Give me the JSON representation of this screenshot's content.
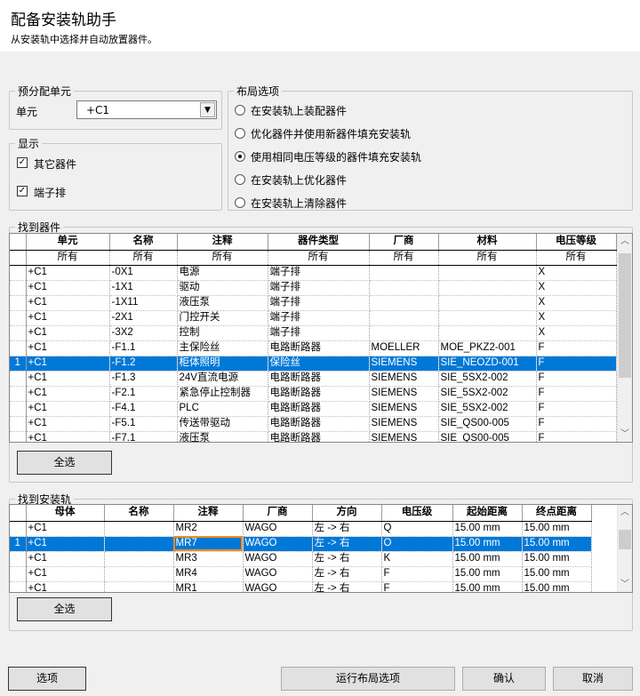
{
  "header": {
    "title": "配备安装轨助手",
    "subtitle": "从安装轨中选择并自动放置器件。"
  },
  "preassign": {
    "legend": "预分配单元",
    "unit_label": "单元",
    "unit_value": "+C1"
  },
  "display": {
    "legend": "显示",
    "other_devices": "其它器件",
    "terminal_strips": "端子排"
  },
  "layout": {
    "legend": "布局选项",
    "options": [
      "在安装轨上装配器件",
      "优化器件并使用新器件填充安装轨",
      "使用相同电压等级的器件填充安装轨",
      "在安装轨上优化器件",
      "在安装轨上清除器件"
    ],
    "selected_index": 2
  },
  "devices": {
    "legend": "找到器件",
    "columns": [
      "单元",
      "名称",
      "注释",
      "器件类型",
      "厂商",
      "材料",
      "电压等级"
    ],
    "filter": [
      "所有",
      "所有",
      "所有",
      "所有",
      "所有",
      "所有",
      "所有"
    ],
    "rows": [
      {
        "idx": "",
        "cells": [
          "+C1",
          "-0X1",
          "电源",
          "端子排",
          "",
          "",
          "X"
        ]
      },
      {
        "idx": "",
        "cells": [
          "+C1",
          "-1X1",
          "驱动",
          "端子排",
          "",
          "",
          "X"
        ]
      },
      {
        "idx": "",
        "cells": [
          "+C1",
          "-1X11",
          "液压泵",
          "端子排",
          "",
          "",
          "X"
        ]
      },
      {
        "idx": "",
        "cells": [
          "+C1",
          "-2X1",
          "门控开关",
          "端子排",
          "",
          "",
          "X"
        ]
      },
      {
        "idx": "",
        "cells": [
          "+C1",
          "-3X2",
          "控制",
          "端子排",
          "",
          "",
          "X"
        ]
      },
      {
        "idx": "",
        "cells": [
          "+C1",
          "-F1.1",
          "主保险丝",
          "电路断路器",
          "MOELLER",
          "MOE_PKZ2-001",
          "F"
        ]
      },
      {
        "idx": "1",
        "cells": [
          "+C1",
          "-F1.2",
          "柜体照明",
          "保险丝",
          "SIEMENS",
          "SIE_NEOZD-001",
          "F"
        ]
      },
      {
        "idx": "",
        "cells": [
          "+C1",
          "-F1.3",
          "24V直流电源",
          "电路断路器",
          "SIEMENS",
          "SIE_5SX2-002",
          "F"
        ]
      },
      {
        "idx": "",
        "cells": [
          "+C1",
          "-F2.1",
          "紧急停止控制器",
          "电路断路器",
          "SIEMENS",
          "SIE_5SX2-002",
          "F"
        ]
      },
      {
        "idx": "",
        "cells": [
          "+C1",
          "-F4.1",
          "PLC",
          "电路断路器",
          "SIEMENS",
          "SIE_5SX2-002",
          "F"
        ]
      },
      {
        "idx": "",
        "cells": [
          "+C1",
          "-F5.1",
          "传送带驱动",
          "电路断路器",
          "SIEMENS",
          "SIE_QS00-005",
          "F"
        ]
      },
      {
        "idx": "",
        "cells": [
          "+C1",
          "-F7.1",
          "液压泵",
          "电路断路器",
          "SIEMENS",
          "SIE_QS00-005",
          "F"
        ]
      }
    ],
    "selected_row": 6,
    "select_all": "全选"
  },
  "rails": {
    "legend": "找到安装轨",
    "columns": [
      "母体",
      "名称",
      "注释",
      "厂商",
      "方向",
      "电压级",
      "起始距离",
      "终点距离"
    ],
    "rows": [
      {
        "idx": "",
        "cells": [
          "+C1",
          "",
          "MR2",
          "WAGO",
          "左 -> 右",
          "Q",
          "15.00 mm",
          "15.00 mm"
        ]
      },
      {
        "idx": "1",
        "cells": [
          "+C1",
          "",
          "MR7",
          "WAGO",
          "左 -> 右",
          "O",
          "15.00 mm",
          "15.00 mm"
        ]
      },
      {
        "idx": "",
        "cells": [
          "+C1",
          "",
          "MR3",
          "WAGO",
          "左 -> 右",
          "K",
          "15.00 mm",
          "15.00 mm"
        ]
      },
      {
        "idx": "",
        "cells": [
          "+C1",
          "",
          "MR4",
          "WAGO",
          "左 -> 右",
          "F",
          "15.00 mm",
          "15.00 mm"
        ]
      },
      {
        "idx": "",
        "cells": [
          "+C1",
          "",
          "MR1",
          "WAGO",
          "左 -> 右",
          "F",
          "15.00 mm",
          "15.00 mm"
        ]
      }
    ],
    "selected_row": 1,
    "select_all": "全选"
  },
  "footer": {
    "options": "选项",
    "run_layout": "运行布局选项",
    "ok": "确认",
    "cancel": "取消"
  },
  "colors": {
    "selection": "#0078d7",
    "focus_cell": "#f58a1f"
  }
}
